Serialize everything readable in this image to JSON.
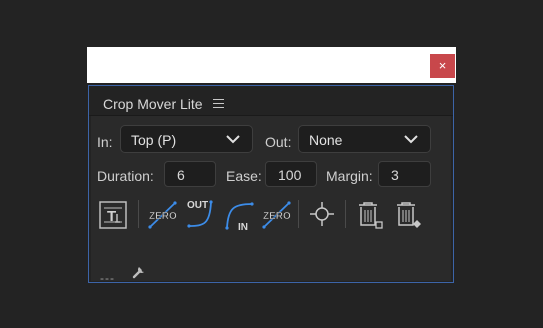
{
  "window": {
    "close_label": "×"
  },
  "panel": {
    "title": "Crop Mover Lite",
    "menu_icon": "hamburger-icon",
    "in": {
      "label": "In:",
      "value": "Top (P)"
    },
    "out": {
      "label": "Out:",
      "value": "None"
    },
    "duration": {
      "label": "Duration:",
      "value": "6"
    },
    "ease": {
      "label": "Ease:",
      "value": "100"
    },
    "margin": {
      "label": "Margin:",
      "value": "3"
    },
    "tools": {
      "zero1": "ZERO",
      "out": "OUT",
      "in": "IN",
      "zero2": "ZERO"
    },
    "footer_dashes": "---",
    "accent_color": "#3c8ce8",
    "border_color": "#3c64a8",
    "close_color": "#c8474b"
  }
}
